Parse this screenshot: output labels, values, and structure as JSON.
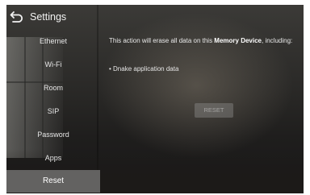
{
  "header": {
    "title": "Settings",
    "back_icon": "back-arrow-icon"
  },
  "sidebar": {
    "items": [
      {
        "label": "Ethernet",
        "active": false
      },
      {
        "label": "Wi-Fi",
        "active": false
      },
      {
        "label": "Room",
        "active": false
      },
      {
        "label": "SIP",
        "active": false
      },
      {
        "label": "Password",
        "active": false
      },
      {
        "label": "Apps",
        "active": false
      },
      {
        "label": "Reset",
        "active": true
      }
    ]
  },
  "main": {
    "message_prefix": "This action will erase all data on this ",
    "message_bold": "Memory Device",
    "message_suffix": ", including:",
    "bullet_items": [
      "• Dnake application data"
    ],
    "reset_label": "RESET",
    "reset_enabled": false
  },
  "colors": {
    "active_item_bg": "#636261",
    "text": "#e6e6e6",
    "background": "#2a2927"
  }
}
